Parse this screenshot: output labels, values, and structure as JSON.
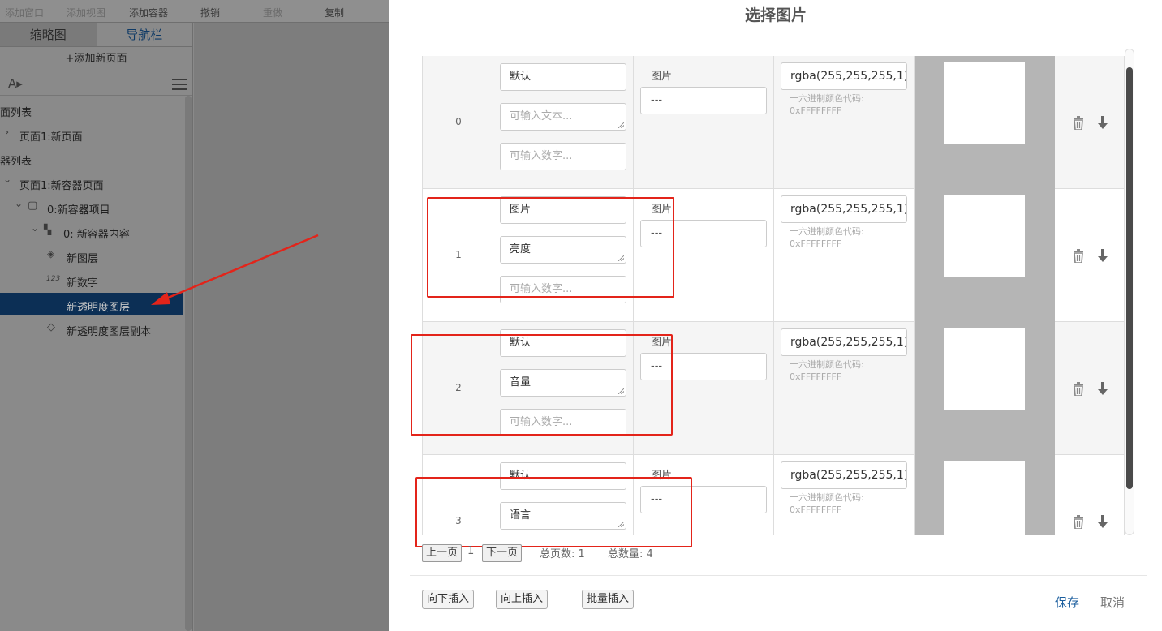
{
  "toolbar": {
    "add_window": "添加窗口",
    "add_view": "添加视图",
    "add_container": "添加容器",
    "undo": "撤销",
    "redo": "重做",
    "copy": "复制"
  },
  "left_panel": {
    "tab_thumbnail": "缩略图",
    "tab_nav": "导航栏",
    "add_page": "+添加新页面",
    "page_list_title": "面列表",
    "page_item": "页面1:新页面",
    "container_list_title": "器列表",
    "container_page": "页面1:新容器页面",
    "container_item": "0:新容器项目",
    "container_content": "0: 新容器内容",
    "layer_new": "新图层",
    "layer_number": "新数字",
    "number_badge": "123",
    "layer_alpha": "新透明度图层",
    "layer_alpha_copy": "新透明度图层副本"
  },
  "dialog": {
    "title": "选择图片",
    "rows": [
      {
        "index": "0",
        "name": "默认",
        "text": "",
        "text_placeholder": "可输入文本...",
        "number_placeholder": "可输入数字...",
        "pic_label": "图片",
        "pic_value": "---",
        "color": "rgba(255,255,255,1)",
        "hint1": "十六进制颜色代码:",
        "hint2": "0xFFFFFFFF",
        "swatch": "#ffffff"
      },
      {
        "index": "1",
        "name": "图片",
        "text": "亮度",
        "text_placeholder": "",
        "number_placeholder": "可输入数字...",
        "pic_label": "图片",
        "pic_value": "---",
        "color": "rgba(255,255,255,1)",
        "hint1": "十六进制颜色代码:",
        "hint2": "0xFFFFFFFF",
        "swatch": "#ffffff"
      },
      {
        "index": "2",
        "name": "默认",
        "text": "音量",
        "text_placeholder": "",
        "number_placeholder": "可输入数字...",
        "pic_label": "图片",
        "pic_value": "---",
        "color": "rgba(255,255,255,1)",
        "hint1": "十六进制颜色代码:",
        "hint2": "0xFFFFFFFF",
        "swatch": "#ffffff"
      },
      {
        "index": "3",
        "name": "默认",
        "text": "语言",
        "text_placeholder": "",
        "number_placeholder": "",
        "pic_label": "图片",
        "pic_value": "---",
        "color": "rgba(255,255,255,1)",
        "hint1": "十六进制颜色代码:",
        "hint2": "0xFFFFFFFF",
        "swatch": "#ffffff"
      }
    ],
    "pager": {
      "prev": "上一页",
      "current": "1",
      "next": "下一页",
      "total_pages": "总页数: 1",
      "total_count": "总数量: 4"
    },
    "footer": {
      "insert_below": "向下插入",
      "insert_above": "向上插入",
      "batch_insert": "批量插入",
      "save": "保存",
      "cancel": "取消"
    }
  },
  "colors": {
    "highlight_box": "#e3241a",
    "selected_row": "#0c2f55",
    "link_blue": "#1b5e9e"
  }
}
